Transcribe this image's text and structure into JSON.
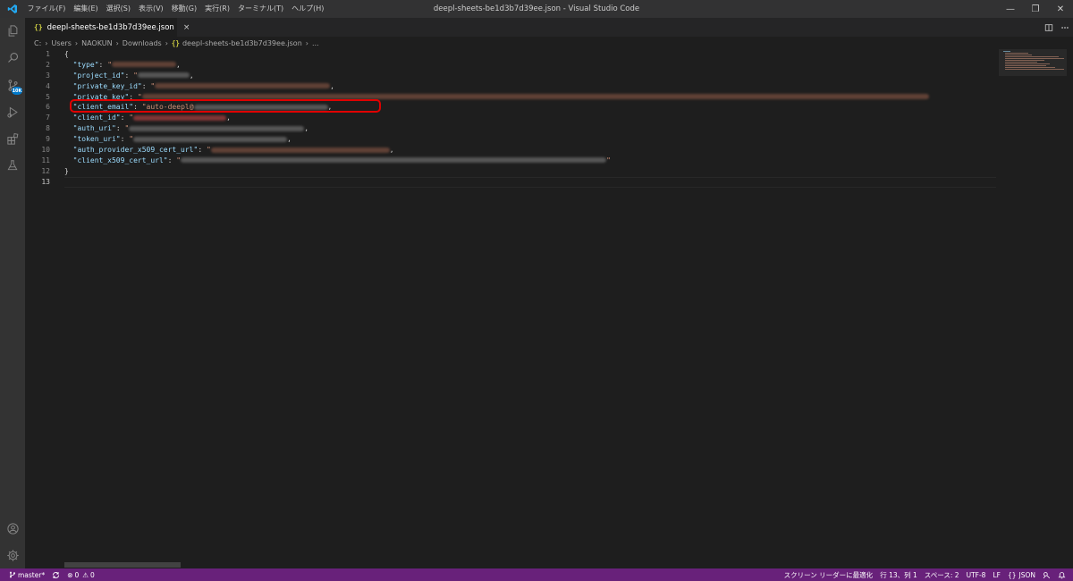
{
  "window": {
    "title": "deepl-sheets-be1d3b7d39ee.json - Visual Studio Code",
    "menu": [
      "ファイル(F)",
      "編集(E)",
      "選択(S)",
      "表示(V)",
      "移動(G)",
      "実行(R)",
      "ターミナル(T)",
      "ヘルプ(H)"
    ],
    "controls": {
      "minimize": "—",
      "restore": "❐",
      "close": "✕"
    }
  },
  "activity_bar": {
    "items": [
      "files-icon",
      "search-icon",
      "source-control-icon",
      "run-debug-icon",
      "extensions-icon",
      "testing-icon"
    ],
    "scm_badge": "10K",
    "bottom": [
      "account-icon",
      "settings-gear-icon"
    ]
  },
  "tabs": [
    {
      "label": "deepl-sheets-be1d3b7d39ee.json",
      "icon": "{}",
      "close": "×",
      "active": true
    }
  ],
  "breadcrumb": {
    "parts": [
      "C:",
      "Users",
      "NAOKUN",
      "Downloads"
    ],
    "file_icon": "{}",
    "file": "deepl-sheets-be1d3b7d39ee.json",
    "trailing": "..."
  },
  "editor": {
    "line_numbers": [
      "1",
      "2",
      "3",
      "4",
      "5",
      "6",
      "7",
      "8",
      "9",
      "10",
      "11",
      "12",
      "13"
    ],
    "active_line": 13,
    "lines": [
      {
        "open": "{"
      },
      {
        "key": "\"type\"",
        "colon": ": ",
        "quote": "\"",
        "comma": ","
      },
      {
        "key": "\"project_id\"",
        "colon": ": ",
        "quote": "\"",
        "comma": ","
      },
      {
        "key": "\"private_key_id\"",
        "colon": ": ",
        "quote": "\"",
        "comma": ","
      },
      {
        "key": "\"private_key\"",
        "colon": ": ",
        "quote": "\""
      },
      {
        "key": "\"client_email\"",
        "colon": ": ",
        "value_prefix": "\"auto-deepl@",
        "comma": ","
      },
      {
        "key": "\"client_id\"",
        "colon": ": ",
        "quote": "\"",
        "comma": ","
      },
      {
        "key": "\"auth_uri\"",
        "colon": ": ",
        "quote": "\"",
        "comma": ","
      },
      {
        "key": "\"token_uri\"",
        "colon": ": ",
        "quote": "\"",
        "comma": ","
      },
      {
        "key": "\"auth_provider_x509_cert_url\"",
        "colon": ": ",
        "quote": "\"",
        "comma": ","
      },
      {
        "key": "\"client_x509_cert_url\"",
        "colon": ": ",
        "quote": "\""
      },
      {
        "close": "}"
      },
      {
        "text": ""
      }
    ],
    "highlight_color": "#e00000"
  },
  "status_bar": {
    "branch": "master*",
    "errors": "0",
    "warnings": "0",
    "screen_reader": "スクリーン リーダーに最適化",
    "position": "行 13、列 1",
    "spaces": "スペース: 2",
    "encoding": "UTF-8",
    "eol": "LF",
    "language": "JSON",
    "background": "#68217a"
  }
}
